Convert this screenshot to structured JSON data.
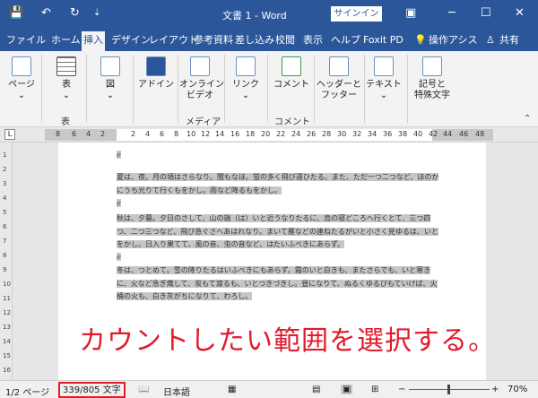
{
  "titlebar": {
    "save_icon": "💾",
    "undo_icon": "↶",
    "redo_icon": "↻",
    "qa_menu": "⇣",
    "title": "文書 1 - Word",
    "signin": "サインイン",
    "ribbon_display_icon": "▣",
    "minimize": "─",
    "maximize": "☐",
    "close": "✕"
  },
  "tabs": [
    "ファイル",
    "ホーム",
    "挿入",
    "デザイン",
    "レイアウト",
    "参考資料",
    "差し込み",
    "校閲",
    "表示",
    "ヘルプ",
    "Foxit PD"
  ],
  "tab_extra": {
    "tellme": "操作アシス",
    "share": "共有"
  },
  "ribbon": {
    "page": "ページ",
    "table": "表",
    "picture": "図",
    "addin": "アドイン",
    "online_video": "オンライン",
    "online_video2": "ビデオ",
    "link": "リンク",
    "comment": "コメント",
    "header_footer": "ヘッダーと",
    "header_footer2": "フッター",
    "text": "テキスト",
    "symbols": "記号と",
    "symbols2": "特殊文字",
    "groups": {
      "table": "表",
      "media": "メディア",
      "comment": "コメント"
    },
    "arrow": "⌄"
  },
  "ruler": {
    "tab_icon": "L",
    "left_ticks": [
      "8",
      "6",
      "4",
      "2"
    ],
    "right_ticks": [
      "2",
      "4",
      "6",
      "8",
      "10",
      "12",
      "14",
      "16",
      "18",
      "20",
      "22",
      "24",
      "26",
      "28",
      "30",
      "32",
      "34",
      "36",
      "38",
      "40",
      "42",
      "44",
      "46",
      "48"
    ],
    "vticks": [
      "1",
      "2",
      "3",
      "4",
      "5",
      "6",
      "7",
      "8",
      "9",
      "10",
      "11",
      "12",
      "13",
      "14",
      "15",
      "16"
    ]
  },
  "doc": {
    "p1": "夏は、夜。月の頃はさらなり。闇もなほ。蛍の多く飛び違ひたる。また、ただ一つ二つなど、ほのかにうち光りて行くもをかし。雨など降るもをかし。",
    "p2": "秋は、夕暮。夕日のさして、山の端（は）いと近うなりたるに、烏の寝どころへ行くとて、三つ四つ、二つ三つなど、飛び急ぐさへあはれなり。まいて雁などの連ねたるがいと小さく見ゆるは、いとをかし。日入り果てて、風の音、虫の音など、はたいふべきにあらず。",
    "p3": "冬は、つとめて。雪の降りたるはいふべきにもあらず。霜のいと白きも、またさらでも、いと寒きに、火など急ぎ熾して、炭もて渡るも、いとつきづきし。昼になりて、ぬるくゆるびもていけば、火桶の火も、白き灰がちになりて、わろし。",
    "mark": "ℯ",
    "annotation": "カウントしたい範囲を選択する。"
  },
  "status": {
    "page": "1/2 ページ",
    "word_count": "339/805 文字",
    "lang": "日本語",
    "zoom_minus": "−",
    "zoom_plus": "+",
    "zoom": "70%"
  }
}
